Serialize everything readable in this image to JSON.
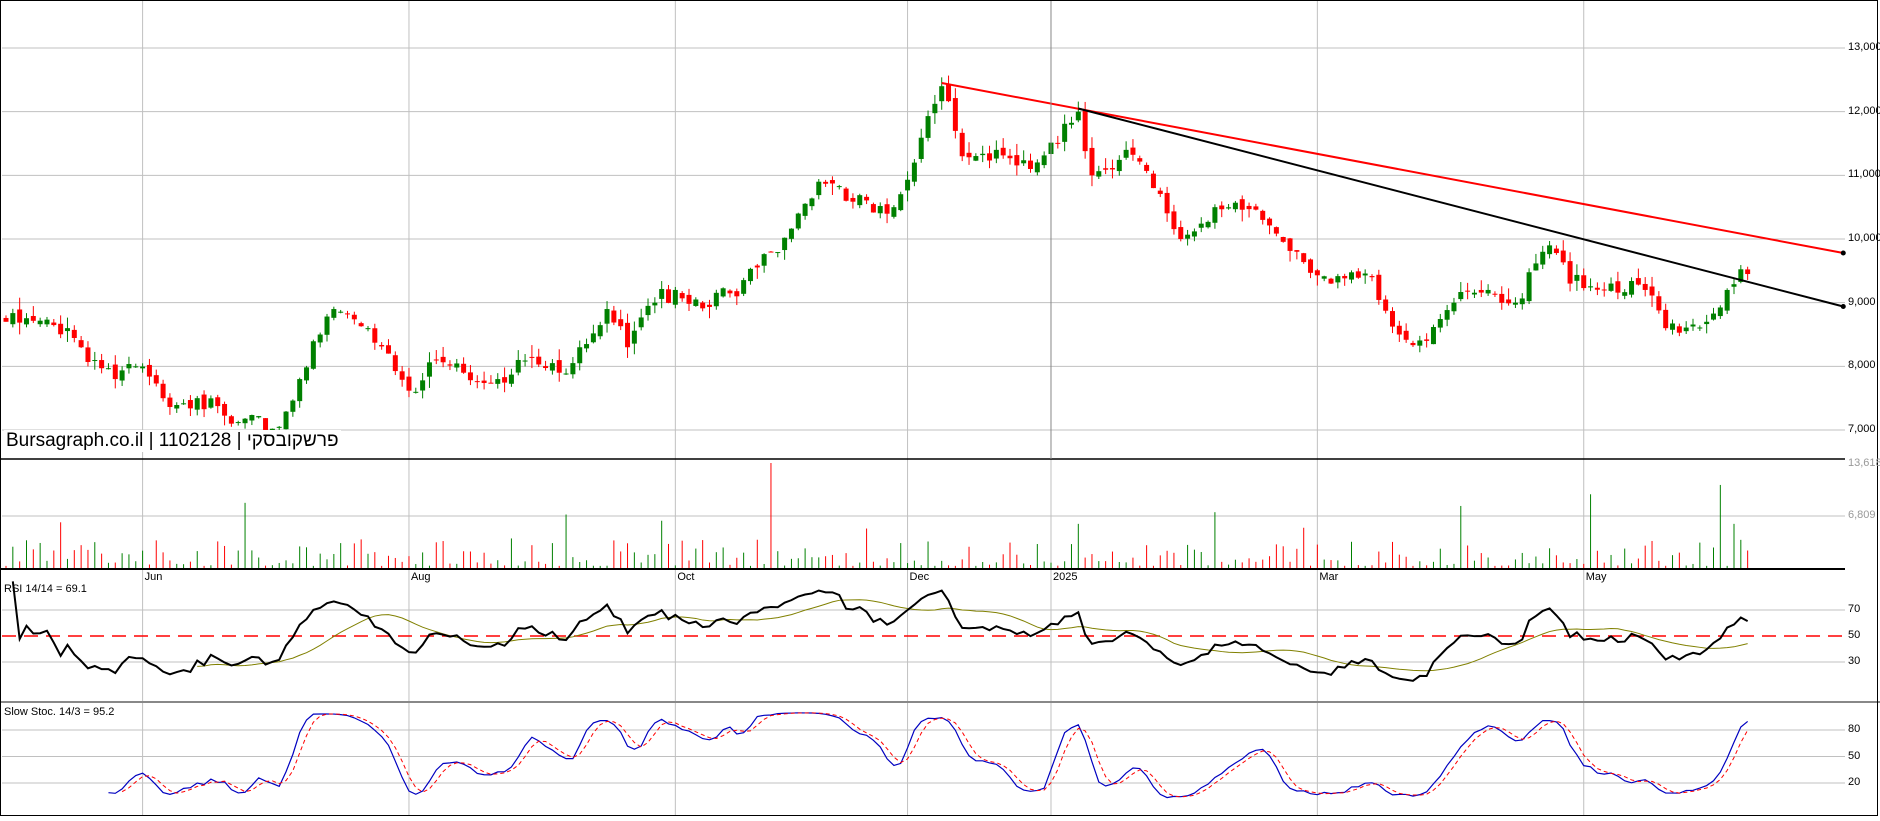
{
  "header": {
    "brand": "Bursagraph.co.il",
    "separator": "|",
    "symbol_id": "1102128",
    "name": "פרשקובסקי"
  },
  "indicators": {
    "rsi_label": "RSI 14/14 = 69.1",
    "stoch_label": "Slow Stoc. 14/3 = 95.2"
  },
  "colors": {
    "up": "#008000",
    "down": "#ff0000",
    "grid": "#c0c0c0",
    "trend_red": "#ff0000",
    "trend_black": "#000000",
    "rsi": "#000000",
    "rsi_ma": "#808000",
    "stoch_k": "#0000c0",
    "stoch_d": "#ff0000"
  },
  "chart_data": {
    "type": "candlestick",
    "x_months": [
      {
        "label": "Jun",
        "day": 20
      },
      {
        "label": "Aug",
        "day": 59
      },
      {
        "label": "Oct",
        "day": 98
      },
      {
        "label": "Dec",
        "day": 132
      },
      {
        "label": "2025",
        "day": 153
      },
      {
        "label": "Mar",
        "day": 192
      },
      {
        "label": "May",
        "day": 231
      }
    ],
    "y_ticks": [
      "7,000",
      "8,000",
      "9,000",
      "10,000",
      "11,000",
      "12,000",
      "13,000"
    ],
    "y_tick_values": [
      7000,
      8000,
      9000,
      10000,
      11000,
      12000,
      13000
    ],
    "ylim": [
      6800,
      13700
    ],
    "days": 256,
    "close_anchors": [
      [
        0,
        8700
      ],
      [
        9,
        8600
      ],
      [
        11,
        8300
      ],
      [
        16,
        7800
      ],
      [
        19,
        8000
      ],
      [
        23,
        7500
      ],
      [
        28,
        7500
      ],
      [
        33,
        7100
      ],
      [
        40,
        7050
      ],
      [
        43,
        7800
      ],
      [
        46,
        8500
      ],
      [
        48,
        8900
      ],
      [
        53,
        8600
      ],
      [
        56,
        8200
      ],
      [
        60,
        7600
      ],
      [
        63,
        8100
      ],
      [
        67,
        7900
      ],
      [
        72,
        7800
      ],
      [
        75,
        8100
      ],
      [
        81,
        7900
      ],
      [
        84,
        8300
      ],
      [
        88,
        8900
      ],
      [
        91,
        8300
      ],
      [
        95,
        9000
      ],
      [
        98,
        9200
      ],
      [
        101,
        9050
      ],
      [
        107,
        9100
      ],
      [
        112,
        9800
      ],
      [
        116,
        10400
      ],
      [
        119,
        10900
      ],
      [
        123,
        10600
      ],
      [
        130,
        10500
      ],
      [
        133,
        11200
      ],
      [
        137,
        12400
      ],
      [
        140,
        11300
      ],
      [
        145,
        11400
      ],
      [
        150,
        11100
      ],
      [
        154,
        11500
      ],
      [
        157,
        12000
      ],
      [
        159,
        11000
      ],
      [
        164,
        11400
      ],
      [
        168,
        10800
      ],
      [
        172,
        10000
      ],
      [
        177,
        10500
      ],
      [
        184,
        10300
      ],
      [
        189,
        9800
      ],
      [
        194,
        9300
      ],
      [
        200,
        9400
      ],
      [
        204,
        8500
      ],
      [
        208,
        8400
      ],
      [
        212,
        9000
      ],
      [
        217,
        9200
      ],
      [
        221,
        9000
      ],
      [
        226,
        9900
      ],
      [
        229,
        9300
      ],
      [
        235,
        9300
      ],
      [
        240,
        9200
      ],
      [
        243,
        8600
      ],
      [
        249,
        8700
      ],
      [
        252,
        9200
      ],
      [
        255,
        9450
      ]
    ],
    "trendlines": [
      {
        "name": "resistance-red",
        "from": [
          137,
          12450
        ],
        "to": [
          269,
          9780
        ]
      },
      {
        "name": "resistance-black",
        "from": [
          157,
          12050
        ],
        "to": [
          269,
          8940
        ]
      }
    ],
    "volume": {
      "ticks": [
        "13,618",
        "6,809"
      ],
      "tick_values": [
        13618,
        6809
      ],
      "max": 13618,
      "spikes": [
        [
          8,
          6000
        ],
        [
          35,
          8500
        ],
        [
          82,
          7000
        ],
        [
          96,
          6200
        ],
        [
          112,
          13618
        ],
        [
          126,
          5200
        ],
        [
          157,
          5800
        ],
        [
          177,
          7300
        ],
        [
          190,
          5300
        ],
        [
          213,
          8100
        ],
        [
          232,
          9600
        ],
        [
          251,
          10800
        ],
        [
          253,
          5800
        ]
      ]
    },
    "rsi": {
      "period": 14,
      "ma": 14,
      "ticks": [
        "70",
        "50",
        "30"
      ],
      "tick_values": [
        70,
        50,
        30
      ],
      "last": 69.1
    },
    "stoch": {
      "period": 14,
      "smooth": 3,
      "ticks": [
        "80",
        "50",
        "20"
      ],
      "tick_values": [
        80,
        50,
        20
      ],
      "last": 95.2
    }
  }
}
